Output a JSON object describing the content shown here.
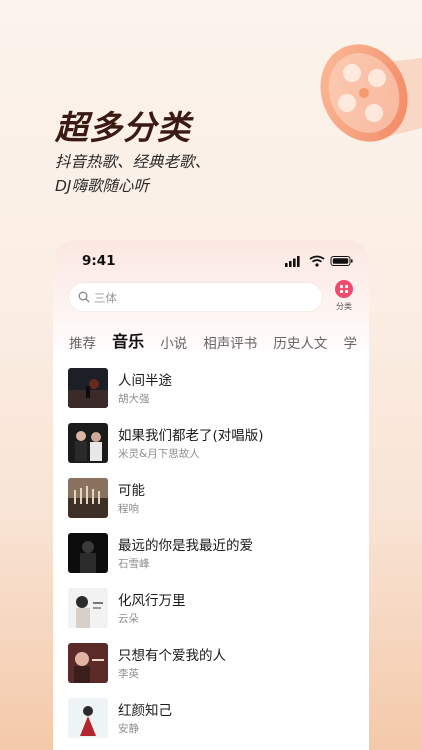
{
  "headline": "超多分类",
  "subline_1": "抖音热歌、经典老歌、",
  "subline_2": "DJ嗨歌随心听",
  "status_bar": {
    "time": "9:41"
  },
  "search": {
    "placeholder": "三体"
  },
  "category_button": {
    "label": "分类"
  },
  "tabs": [
    {
      "label": "推荐",
      "active": false
    },
    {
      "label": "音乐",
      "active": true
    },
    {
      "label": "小说",
      "active": false
    },
    {
      "label": "相声评书",
      "active": false
    },
    {
      "label": "历史人文",
      "active": false
    },
    {
      "label": "学",
      "active": false
    }
  ],
  "songs": [
    {
      "title": "人间半途",
      "artist": "胡大强"
    },
    {
      "title": "如果我们都老了(对唱版)",
      "artist": "米灵&月下思故人"
    },
    {
      "title": "可能",
      "artist": "程响"
    },
    {
      "title": "最远的你是我最近的爱",
      "artist": "石雪峰"
    },
    {
      "title": "化风行万里",
      "artist": "云朵"
    },
    {
      "title": "只想有个爱我的人",
      "artist": "李英"
    },
    {
      "title": "红颜知己",
      "artist": "安静"
    }
  ],
  "colors": {
    "accent": "#ee4b6e",
    "headline": "#3a1a12",
    "reel": "#f59a6b"
  },
  "icons": {
    "search": "search-icon",
    "category": "grid-dots-icon",
    "signal": "signal-icon",
    "wifi": "wifi-icon",
    "battery": "battery-icon",
    "decoration": "film-reel-icon"
  }
}
